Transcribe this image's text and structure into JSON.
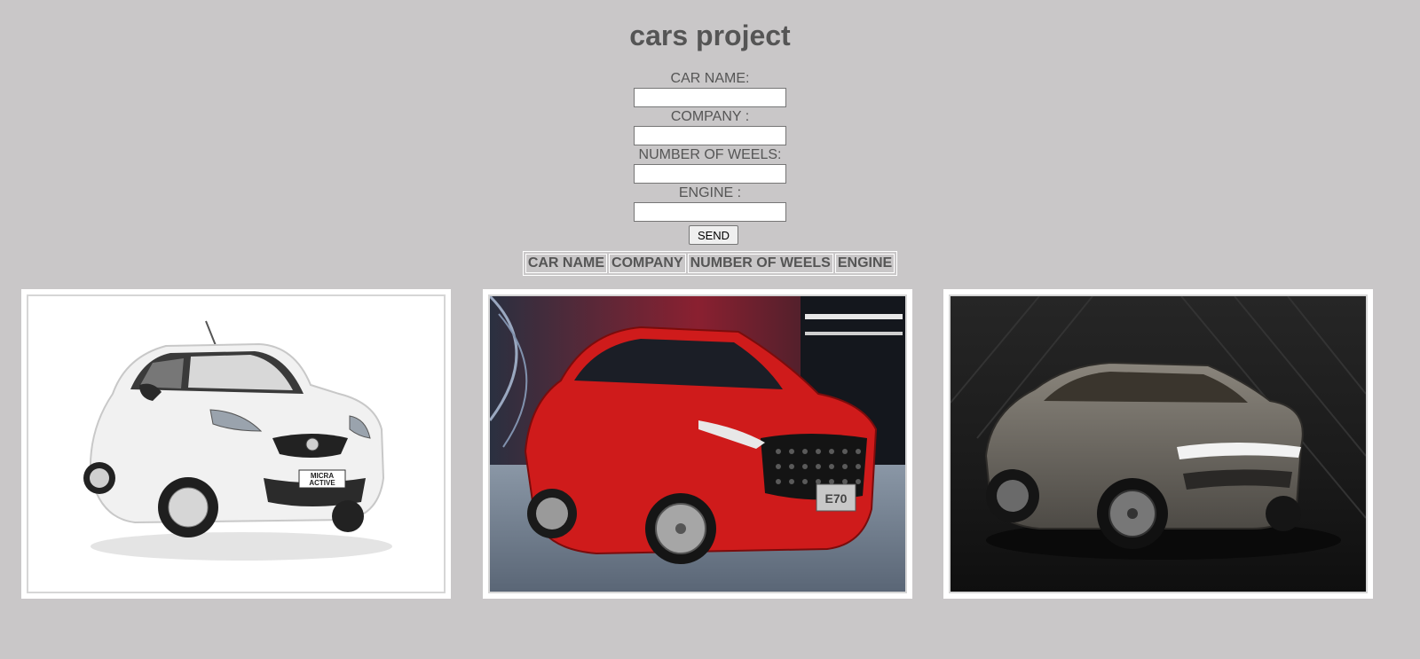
{
  "page": {
    "title": "cars project"
  },
  "form": {
    "fields": [
      {
        "label": "CAR NAME:",
        "value": ""
      },
      {
        "label": "COMPANY :",
        "value": ""
      },
      {
        "label": "NUMBER OF WEELS:",
        "value": ""
      },
      {
        "label": "ENGINE :",
        "value": ""
      }
    ],
    "send_label": "SEND"
  },
  "table": {
    "headers": [
      "CAR NAME",
      "COMPANY",
      "NUMBER OF WEELS",
      "ENGINE"
    ]
  },
  "gallery": {
    "photos": [
      {
        "subject": "white-hatchback-car-photo",
        "plate_text": "MICRA ACTIVE",
        "colors": {
          "body": "#eeeeee",
          "background": "#ffffff"
        }
      },
      {
        "subject": "red-sedan-car-photo",
        "plate_text": "E70",
        "colors": {
          "body": "#d01a1a",
          "background": "#3a3f4a"
        }
      },
      {
        "subject": "grey-concept-suv-photo",
        "plate_text": "",
        "colors": {
          "body": "#6e6a63",
          "background": "#1e1e1e"
        }
      }
    ]
  }
}
